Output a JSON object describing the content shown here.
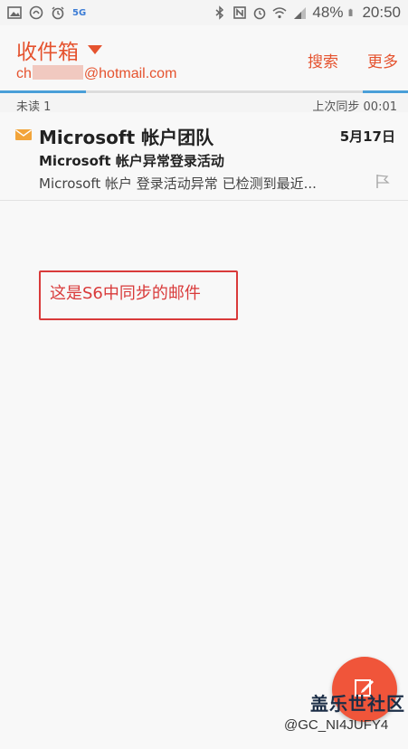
{
  "status_bar": {
    "left_icons": [
      "gallery-icon",
      "samsung-icon",
      "alarm-icon",
      "5g-icon"
    ],
    "network_label": "5G",
    "right_icons": [
      "bluetooth-icon",
      "nfc-icon",
      "alarm-icon",
      "wifi-icon",
      "signal-icon",
      "battery-icon"
    ],
    "battery": "48%",
    "time": "20:50"
  },
  "header": {
    "folder": "收件箱",
    "email_prefix": "ch",
    "email_suffix": "@hotmail.com",
    "search": "搜索",
    "more": "更多"
  },
  "sync_progress": 0.21,
  "info": {
    "unread": "未读 1",
    "last_sync": "上次同步  00:01"
  },
  "emails": [
    {
      "sender": "Microsoft 帐户团队",
      "date": "5月17日",
      "subject": "Microsoft 帐户异常登录活动",
      "preview": "Microsoft 帐户 登录活动异常 已检测到最近..."
    }
  ],
  "annotation": "这是S6中同步的邮件",
  "watermark": {
    "line1": "盖乐世社区",
    "line2": "@GC_NI4JUFY4"
  },
  "colors": {
    "accent": "#e5532f",
    "sync_bar": "#4a9fd8",
    "annotation": "#d93a3a",
    "fab": "#f0553a"
  }
}
